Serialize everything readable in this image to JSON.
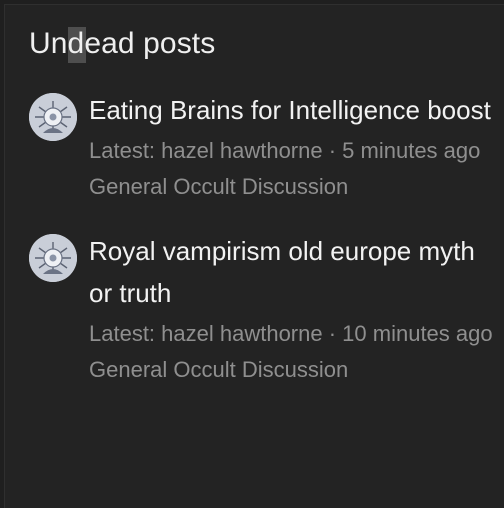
{
  "widget": {
    "title": "Undead posts"
  },
  "posts": [
    {
      "title": "Eating Brains for Intelligence boost",
      "latest_prefix": "Latest: ",
      "author": "hazel hawthorne",
      "separator": " · ",
      "time_ago": "5 minutes ago",
      "category": "General Occult Discussion",
      "avatar_icon": "user-avatar-icon"
    },
    {
      "title": "Royal vampirism old europe myth or truth",
      "latest_prefix": "Latest: ",
      "author": "hazel hawthorne",
      "separator": " · ",
      "time_ago": "10 minutes ago",
      "category": "General Occult Discussion",
      "avatar_icon": "user-avatar-icon"
    }
  ],
  "colors": {
    "background": "#232323",
    "title_text": "#f2f2f2",
    "meta_text": "#8f8f8f"
  }
}
